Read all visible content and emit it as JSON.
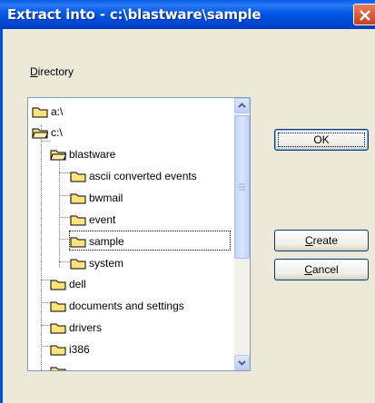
{
  "window": {
    "title": "Extract into  - c:\\blastware\\sample"
  },
  "directory": {
    "label_prefix": "D",
    "label_rest": "irectory"
  },
  "tree": {
    "items": [
      {
        "label": "a:\\",
        "icon": "folder-icon"
      },
      {
        "label": "c:\\",
        "icon": "open-folder-icon"
      },
      {
        "label": "blastware",
        "icon": "open-folder-icon"
      },
      {
        "label": "ascii converted events",
        "icon": "folder-icon"
      },
      {
        "label": "bwmail",
        "icon": "folder-icon"
      },
      {
        "label": "event",
        "icon": "folder-icon"
      },
      {
        "label": "sample",
        "icon": "folder-icon",
        "selected": true
      },
      {
        "label": "system",
        "icon": "folder-icon"
      },
      {
        "label": "dell",
        "icon": "folder-icon"
      },
      {
        "label": "documents and settings",
        "icon": "folder-icon"
      },
      {
        "label": "drivers",
        "icon": "folder-icon"
      },
      {
        "label": "i386",
        "icon": "folder-icon"
      }
    ]
  },
  "buttons": {
    "ok": {
      "label_prefix": "",
      "label": "OK"
    },
    "create": {
      "accel": "C",
      "rest": "reate"
    },
    "cancel": {
      "accel": "C",
      "rest": "ancel"
    }
  }
}
